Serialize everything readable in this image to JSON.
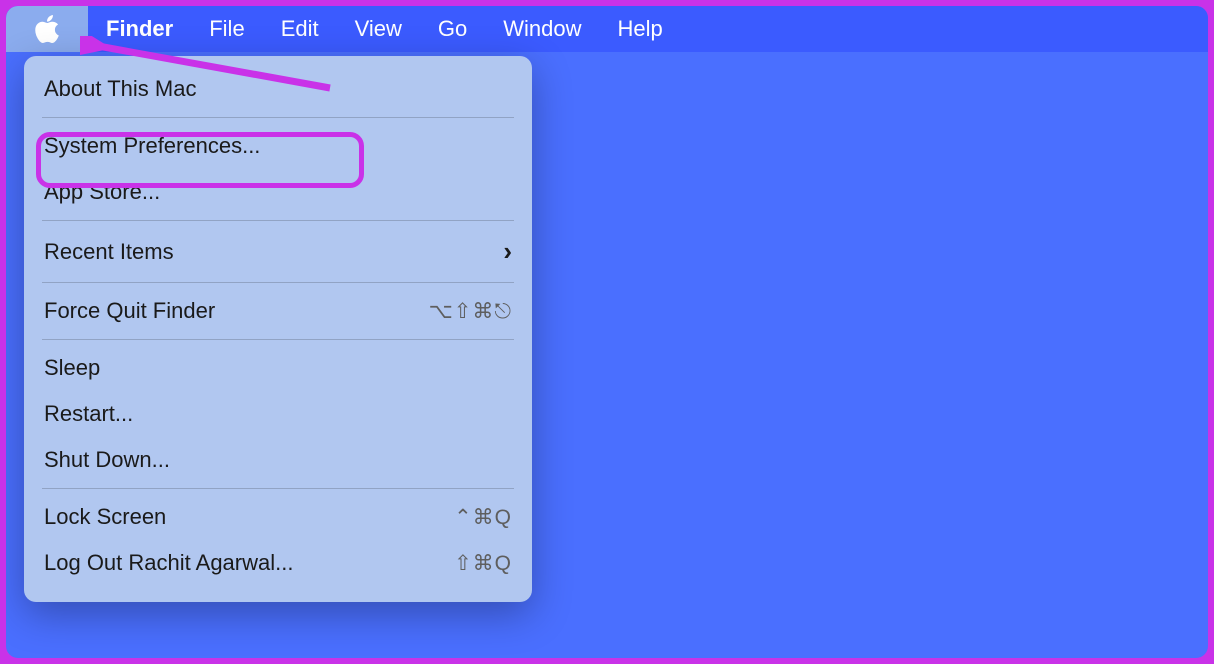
{
  "menubar": {
    "items": [
      {
        "label": "Finder",
        "is_active_app": true
      },
      {
        "label": "File"
      },
      {
        "label": "Edit"
      },
      {
        "label": "View"
      },
      {
        "label": "Go"
      },
      {
        "label": "Window"
      },
      {
        "label": "Help"
      }
    ]
  },
  "apple_menu": {
    "groups": [
      [
        {
          "label": "About This Mac",
          "shortcut": "",
          "submenu": false
        }
      ],
      [
        {
          "label": "System Preferences...",
          "shortcut": "",
          "submenu": false,
          "highlighted": true
        },
        {
          "label": "App Store...",
          "shortcut": "",
          "submenu": false
        }
      ],
      [
        {
          "label": "Recent Items",
          "shortcut": "",
          "submenu": true
        }
      ],
      [
        {
          "label": "Force Quit Finder",
          "shortcut": "⌥⇧⌘⎋",
          "submenu": false
        }
      ],
      [
        {
          "label": "Sleep",
          "shortcut": "",
          "submenu": false
        },
        {
          "label": "Restart...",
          "shortcut": "",
          "submenu": false
        },
        {
          "label": "Shut Down...",
          "shortcut": "",
          "submenu": false
        }
      ],
      [
        {
          "label": "Lock Screen",
          "shortcut": "⌃⌘Q",
          "submenu": false
        },
        {
          "label": "Log Out Rachit Agarwal...",
          "shortcut": "⇧⌘Q",
          "submenu": false
        }
      ]
    ]
  },
  "annotations": {
    "highlight_color": "#C932E8",
    "arrow_from": "apple-icon",
    "arrow_to": "dropdown-top"
  }
}
